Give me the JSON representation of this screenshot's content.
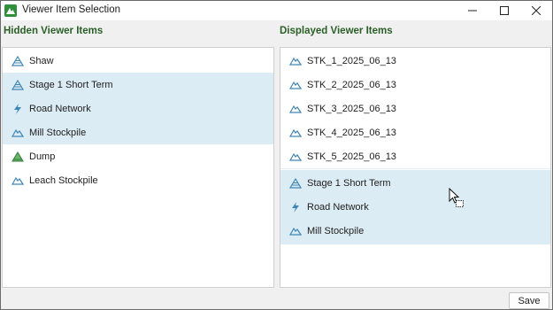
{
  "window": {
    "title": "Viewer Item Selection"
  },
  "hidden_panel": {
    "header": "Hidden Viewer Items",
    "items": [
      {
        "label": "Shaw",
        "icon": "pit-icon",
        "selected": false
      },
      {
        "label": "Stage 1 Short Term",
        "icon": "pit-icon",
        "selected": true
      },
      {
        "label": "Road Network",
        "icon": "road-network-icon",
        "selected": true
      },
      {
        "label": "Mill Stockpile",
        "icon": "stockpile-icon",
        "selected": true
      },
      {
        "label": "Dump",
        "icon": "dump-icon",
        "selected": false
      },
      {
        "label": "Leach Stockpile",
        "icon": "stockpile-icon",
        "selected": false
      }
    ]
  },
  "displayed_panel": {
    "header": "Displayed Viewer Items",
    "items": [
      {
        "label": "STK_1_2025_06_13",
        "icon": "stockpile-icon"
      },
      {
        "label": "STK_2_2025_06_13",
        "icon": "stockpile-icon"
      },
      {
        "label": "STK_3_2025_06_13",
        "icon": "stockpile-icon"
      },
      {
        "label": "STK_4_2025_06_13",
        "icon": "stockpile-icon"
      },
      {
        "label": "STK_5_2025_06_13",
        "icon": "stockpile-icon"
      }
    ],
    "drag_preview": [
      {
        "label": "Stage 1 Short Term",
        "icon": "pit-icon"
      },
      {
        "label": "Road Network",
        "icon": "road-network-icon"
      },
      {
        "label": "Mill Stockpile",
        "icon": "stockpile-icon"
      }
    ]
  },
  "footer": {
    "save_label": "Save"
  },
  "colors": {
    "header_green": "#2a5f28",
    "selection": "#dcecf4",
    "icon_blue": "#3f86b8",
    "app_green": "#2f8f3a"
  }
}
